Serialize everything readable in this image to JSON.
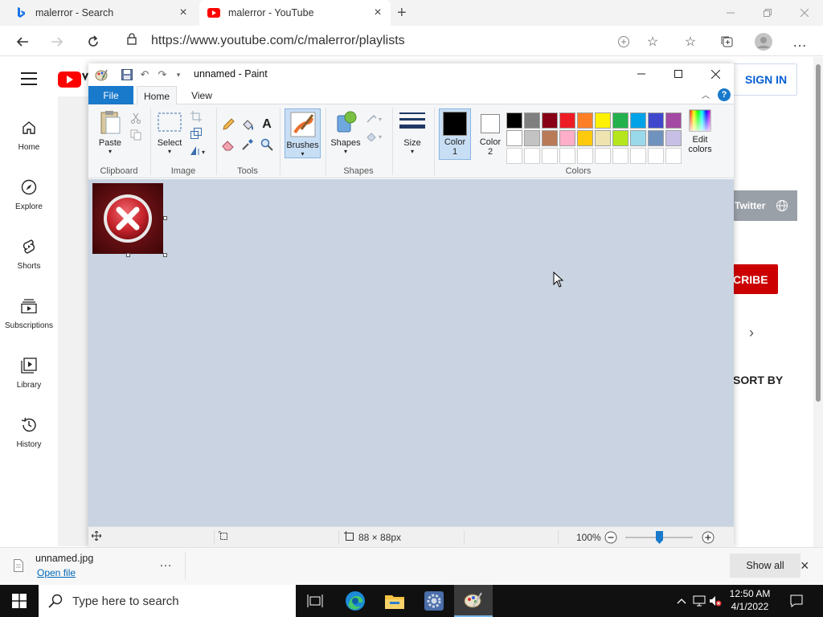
{
  "browser": {
    "tabs": [
      {
        "title": "malerror - Search",
        "active": false
      },
      {
        "title": "malerror - YouTube",
        "active": true
      }
    ],
    "url": "https://www.youtube.com/c/malerror/playlists"
  },
  "youtube": {
    "nav": [
      {
        "label": "Home",
        "icon": "home-icon"
      },
      {
        "label": "Explore",
        "icon": "compass-icon"
      },
      {
        "label": "Shorts",
        "icon": "shorts-icon"
      },
      {
        "label": "Subscriptions",
        "icon": "subscriptions-icon"
      },
      {
        "label": "Library",
        "icon": "library-icon"
      },
      {
        "label": "History",
        "icon": "history-icon"
      }
    ],
    "sign_in": "SIGN IN",
    "subscribe_partial": "CRIBE",
    "sort_by_partial": "SORT BY",
    "twitter_partial": "Twitter"
  },
  "paint": {
    "title": "unnamed - Paint",
    "tabs": {
      "file": "File",
      "home": "Home",
      "view": "View"
    },
    "ribbon": {
      "paste": "Paste",
      "select": "Select",
      "brushes": "Brushes",
      "shapes": "Shapes",
      "size": "Size",
      "color1": "Color",
      "color1_num": "1",
      "color2": "Color",
      "color2_num": "2",
      "edit_colors_1": "Edit",
      "edit_colors_2": "colors",
      "groups": {
        "clipboard": "Clipboard",
        "image": "Image",
        "tools": "Tools",
        "shapes": "Shapes",
        "colors": "Colors"
      }
    },
    "palette_row1": [
      "#000000",
      "#7f7f7f",
      "#880015",
      "#ed1c24",
      "#ff7f27",
      "#fff200",
      "#22b14c",
      "#00a2e8",
      "#3f48cc",
      "#a349a4"
    ],
    "palette_row2": [
      "#ffffff",
      "#c3c3c3",
      "#b97a57",
      "#ffaec9",
      "#ffc90e",
      "#efe4b0",
      "#b5e61d",
      "#99d9ea",
      "#7092be",
      "#c8bfe7"
    ],
    "color1_value": "#000000",
    "color2_value": "#ffffff",
    "status": {
      "image_size": "88 × 88px",
      "zoom": "100%"
    }
  },
  "download": {
    "filename": "unnamed.jpg",
    "open_file": "Open file",
    "show_all": "Show all"
  },
  "taskbar": {
    "search_placeholder": "Type here to search",
    "time": "12:50 AM",
    "date": "4/1/2022"
  }
}
